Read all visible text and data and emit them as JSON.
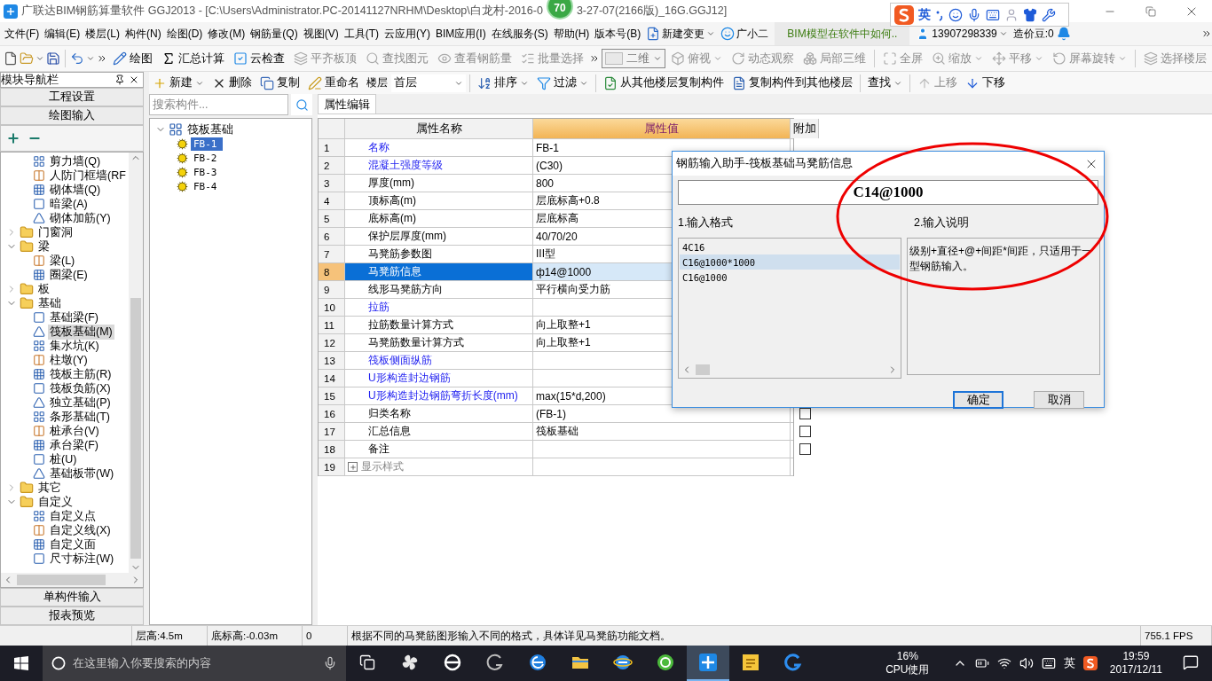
{
  "window": {
    "title_start": "广联达BIM钢筋算量软件 GGJ2013 - [C:\\Users\\Administrator.PC-20141127NRHM\\Desktop\\白龙村-2016-0",
    "badge": "70",
    "title_end": "3-27-07(2166版)_16G.GGJ12]"
  },
  "ime_bar": {
    "mode": "英"
  },
  "menu": [
    "文件(F)",
    "编辑(E)",
    "楼层(L)",
    "构件(N)",
    "绘图(D)",
    "修改(M)",
    "钢筋量(Q)",
    "视图(V)",
    "工具(T)",
    "云应用(Y)",
    "BIM应用(I)",
    "在线服务(S)",
    "帮助(H)",
    "版本号(B)"
  ],
  "menu_extras": {
    "new_change": "新建变更",
    "assistant": "广小二",
    "news": "BIM模型在软件中如何..",
    "account": "13907298339",
    "beans": "造价豆:0"
  },
  "toolbar": [
    {
      "label": "绘图",
      "disabled": false
    },
    {
      "label": "汇总计算",
      "disabled": false
    },
    {
      "label": "云检查",
      "disabled": false
    },
    {
      "label": "平齐板顶",
      "disabled": true
    },
    {
      "label": "查找图元",
      "disabled": true
    },
    {
      "label": "查看钢筋量",
      "disabled": true
    },
    {
      "label": "批量选择",
      "disabled": true
    }
  ],
  "view_mode": "二维",
  "view_tools": [
    {
      "label": "俯视",
      "dropdown": true,
      "disabled": true
    },
    {
      "label": "动态观察",
      "dropdown": false,
      "disabled": true
    },
    {
      "label": "局部三维",
      "dropdown": false,
      "disabled": true
    },
    {
      "label": "全屏",
      "dropdown": false,
      "disabled": true
    },
    {
      "label": "缩放",
      "dropdown": true,
      "disabled": true
    },
    {
      "label": "平移",
      "dropdown": true,
      "disabled": true
    },
    {
      "label": "屏幕旋转",
      "dropdown": true,
      "disabled": true
    },
    {
      "label": "选择楼层",
      "dropdown": false,
      "disabled": true
    }
  ],
  "navigator": {
    "title": "模块导航栏",
    "top_buttons": [
      "工程设置",
      "绘图输入"
    ],
    "bottom_buttons": [
      "单构件输入",
      "报表预览"
    ],
    "tree_continued_children": [
      {
        "label": "剪力墙(Q)",
        "selected": false
      },
      {
        "label": "人防门框墙(RF",
        "selected": false
      },
      {
        "label": "砌体墙(Q)",
        "selected": false
      },
      {
        "label": "暗梁(A)",
        "selected": false
      },
      {
        "label": "砌体加筋(Y)",
        "selected": false
      }
    ],
    "tree": [
      {
        "label": "门窗洞",
        "expanded": false
      },
      {
        "label": "梁",
        "expanded": true,
        "children": [
          {
            "label": "梁(L)",
            "selected": false
          },
          {
            "label": "圈梁(E)",
            "selected": false
          }
        ]
      },
      {
        "label": "板",
        "expanded": false
      },
      {
        "label": "基础",
        "expanded": true,
        "children": [
          {
            "label": "基础梁(F)",
            "selected": false
          },
          {
            "label": "筏板基础(M)",
            "selected": true
          },
          {
            "label": "集水坑(K)",
            "selected": false
          },
          {
            "label": "柱墩(Y)",
            "selected": false
          },
          {
            "label": "筏板主筋(R)",
            "selected": false
          },
          {
            "label": "筏板负筋(X)",
            "selected": false
          },
          {
            "label": "独立基础(P)",
            "selected": false
          },
          {
            "label": "条形基础(T)",
            "selected": false
          },
          {
            "label": "桩承台(V)",
            "selected": false
          },
          {
            "label": "承台梁(F)",
            "selected": false
          },
          {
            "label": "桩(U)",
            "selected": false
          },
          {
            "label": "基础板带(W)",
            "selected": false
          }
        ]
      },
      {
        "label": "其它",
        "expanded": false
      },
      {
        "label": "自定义",
        "expanded": true,
        "children": [
          {
            "label": "自定义点",
            "selected": false
          },
          {
            "label": "自定义线(X)",
            "selected": false
          },
          {
            "label": "自定义面",
            "selected": false
          },
          {
            "label": "尺寸标注(W)",
            "selected": false
          }
        ]
      }
    ]
  },
  "component_toolbar": {
    "edit": [
      {
        "label": "新建",
        "dropdown": true
      },
      {
        "label": "删除",
        "dropdown": false
      },
      {
        "label": "复制",
        "dropdown": false
      },
      {
        "label": "重命名",
        "dropdown": false
      }
    ],
    "floor_label": "楼层",
    "floor": "首层",
    "tools": [
      {
        "label": "排序",
        "dropdown": true,
        "disabled": false
      },
      {
        "label": "过滤",
        "dropdown": true,
        "disabled": false
      },
      {
        "label": "从其他楼层复制构件",
        "dropdown": false,
        "disabled": false
      },
      {
        "label": "复制构件到其他楼层",
        "dropdown": false,
        "disabled": false
      },
      {
        "label": "查找",
        "dropdown": true,
        "disabled": false
      },
      {
        "label": "上移",
        "dropdown": false,
        "disabled": true
      },
      {
        "label": "下移",
        "dropdown": false,
        "disabled": false
      }
    ]
  },
  "component_list": {
    "search_placeholder": "搜索构件...",
    "root": {
      "label": "筏板基础",
      "expanded": true,
      "children": [
        {
          "label": "FB-1",
          "selected": true
        },
        {
          "label": "FB-2",
          "selected": false
        },
        {
          "label": "FB-3",
          "selected": false
        },
        {
          "label": "FB-4",
          "selected": false
        }
      ]
    }
  },
  "properties": {
    "tab": "属性编辑",
    "columns": [
      "属性名称",
      "属性值",
      "附加"
    ],
    "rows": [
      {
        "no": "1",
        "name": "名称",
        "value": "FB-1",
        "public": true,
        "selected": false,
        "kind": "field"
      },
      {
        "no": "2",
        "name": "混凝土强度等级",
        "value": "(C30)",
        "public": true,
        "selected": false,
        "kind": "field"
      },
      {
        "no": "3",
        "name": "厚度(mm)",
        "value": "800",
        "public": false,
        "selected": false,
        "kind": "field"
      },
      {
        "no": "4",
        "name": "顶标高(m)",
        "value": "层底标高+0.8",
        "public": false,
        "selected": false,
        "kind": "field"
      },
      {
        "no": "5",
        "name": "底标高(m)",
        "value": "层底标高",
        "public": false,
        "selected": false,
        "kind": "field"
      },
      {
        "no": "6",
        "name": "保护层厚度(mm)",
        "value": "40/70/20",
        "public": false,
        "selected": false,
        "kind": "field"
      },
      {
        "no": "7",
        "name": "马凳筋参数图",
        "value": "III型",
        "public": false,
        "selected": false,
        "kind": "field"
      },
      {
        "no": "8",
        "name": "马凳筋信息",
        "value": "ф14@1000",
        "public": true,
        "selected": true,
        "kind": "field"
      },
      {
        "no": "9",
        "name": "线形马凳筋方向",
        "value": "平行横向受力筋",
        "public": false,
        "selected": false,
        "kind": "field"
      },
      {
        "no": "10",
        "name": "拉筋",
        "public": true,
        "selected": false,
        "kind": "field"
      },
      {
        "no": "11",
        "name": "拉筋数量计算方式",
        "value": "向上取整+1",
        "public": false,
        "selected": false,
        "kind": "field"
      },
      {
        "no": "12",
        "name": "马凳筋数量计算方式",
        "value": "向上取整+1",
        "public": false,
        "selected": false,
        "kind": "field"
      },
      {
        "no": "13",
        "name": "筏板侧面纵筋",
        "public": true,
        "selected": false,
        "kind": "field"
      },
      {
        "no": "14",
        "name": "U形构造封边钢筋",
        "public": true,
        "selected": false,
        "kind": "field"
      },
      {
        "no": "15",
        "name": "U形构造封边钢筋弯折长度(mm)",
        "value": "max(15*d,200)",
        "public": true,
        "selected": false,
        "kind": "field"
      },
      {
        "no": "16",
        "name": "归类名称",
        "value": "(FB-1)",
        "public": false,
        "selected": false,
        "kind": "field",
        "checked": false
      },
      {
        "no": "17",
        "name": "汇总信息",
        "value": "筏板基础",
        "public": false,
        "selected": false,
        "kind": "field",
        "checked": false
      },
      {
        "no": "18",
        "name": "备注",
        "public": false,
        "selected": false,
        "kind": "field",
        "checked": false
      },
      {
        "no": "19",
        "name": "显示样式",
        "selected": false,
        "kind": "group"
      }
    ]
  },
  "dialog": {
    "title": "钢筋输入助手-筏板基础马凳筋信息",
    "value": "C14@1000",
    "format_label": "1.输入格式",
    "formats": [
      {
        "text": "4C16",
        "selected": false
      },
      {
        "text": "C16@1000*1000",
        "selected": true
      },
      {
        "text": "C16@1000",
        "selected": false
      }
    ],
    "description_label": "2.输入说明",
    "description": "级别+直径+@+间距*间距，只适用于一型钢筋输入。",
    "buttons": [
      {
        "label": "确定",
        "default": true
      },
      {
        "label": "取消",
        "default": false
      }
    ]
  },
  "status_bar": {
    "floor_height": "层高:4.5m",
    "bottom_elevation": "底标高:-0.03m",
    "value": "0",
    "message": "根据不同的马凳筋图形输入不同的格式，具体详见马凳筋功能文档。",
    "fps": "755.1 FPS"
  },
  "taskbar": {
    "search_placeholder": "在这里输入你要搜索的内容",
    "apps": [
      {
        "active": false
      },
      {
        "active": false
      },
      {
        "active": false
      },
      {
        "active": false
      },
      {
        "active": false
      },
      {
        "active": false
      },
      {
        "active": false
      },
      {
        "active": true
      },
      {
        "active": false
      },
      {
        "active": false
      }
    ],
    "cpu": "16%",
    "cpu_label": "CPU使用",
    "language": "英",
    "time": "19:59",
    "date": "2017/12/11"
  }
}
